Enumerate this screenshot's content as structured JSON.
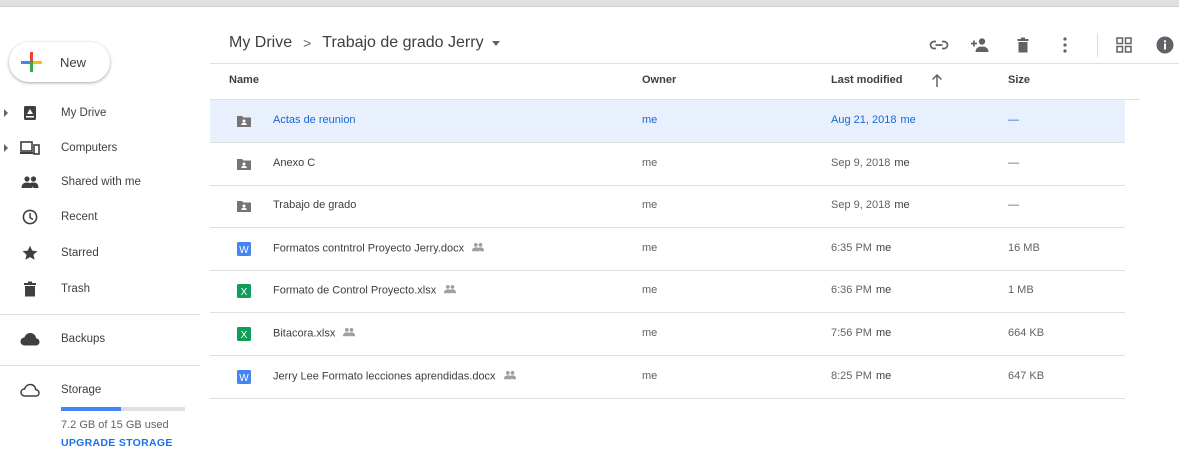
{
  "colors": {
    "accent": "#1a73e8",
    "selected_bg": "#e8f0fe",
    "doc_blue": "#4285f4",
    "sheet_green": "#0f9d58",
    "folder_grey": "#757575"
  },
  "sidebar": {
    "new_label": "New",
    "items": [
      {
        "label": "My Drive",
        "icon": "my-drive-icon"
      },
      {
        "label": "Computers",
        "icon": "computers-icon"
      },
      {
        "label": "Shared with me",
        "icon": "shared-with-me-icon"
      },
      {
        "label": "Recent",
        "icon": "clock-icon"
      },
      {
        "label": "Starred",
        "icon": "star-icon"
      },
      {
        "label": "Trash",
        "icon": "trash-icon"
      },
      {
        "label": "Backups",
        "icon": "cloud-icon"
      },
      {
        "label": "Storage",
        "icon": "cloud-outline-icon"
      }
    ],
    "storage": {
      "used_text": "7.2 GB of 15 GB used",
      "used_fraction": 0.48,
      "upgrade_label": "UPGRADE STORAGE"
    }
  },
  "header": {
    "breadcrumb": [
      "My Drive",
      "Trabajo de grado Jerry"
    ],
    "separator": ">",
    "toolbar_icons": [
      "link-icon",
      "add-person-icon",
      "trash-icon",
      "more-vert-icon",
      "grid-view-icon",
      "info-icon"
    ]
  },
  "table": {
    "columns": {
      "name": "Name",
      "owner": "Owner",
      "modified": "Last modified",
      "size": "Size"
    },
    "rows": [
      {
        "type": "folder",
        "name": "Actas de reunion",
        "shared": false,
        "owner": "me",
        "modified_date": "Aug 21, 2018",
        "modified_by": "me",
        "size": "—",
        "selected": true
      },
      {
        "type": "folder",
        "name": "Anexo C",
        "shared": false,
        "owner": "me",
        "modified_date": "Sep 9, 2018",
        "modified_by": "me",
        "size": "—",
        "selected": false
      },
      {
        "type": "folder",
        "name": "Trabajo de grado",
        "shared": false,
        "owner": "me",
        "modified_date": "Sep 9, 2018",
        "modified_by": "me",
        "size": "—",
        "selected": false
      },
      {
        "type": "doc",
        "name": "Formatos contntrol Proyecto Jerry.docx",
        "shared": true,
        "owner": "me",
        "modified_date": "6:35 PM",
        "modified_by": "me",
        "size": "16 MB",
        "selected": false
      },
      {
        "type": "sheet",
        "name": "Formato de Control Proyecto.xlsx",
        "shared": true,
        "owner": "me",
        "modified_date": "6:36 PM",
        "modified_by": "me",
        "size": "1 MB",
        "selected": false
      },
      {
        "type": "sheet",
        "name": "Bitacora.xlsx",
        "shared": true,
        "owner": "me",
        "modified_date": "7:56 PM",
        "modified_by": "me",
        "size": "664 KB",
        "selected": false
      },
      {
        "type": "doc",
        "name": "Jerry Lee Formato lecciones aprendidas.docx",
        "shared": true,
        "owner": "me",
        "modified_date": "8:25 PM",
        "modified_by": "me",
        "size": "647 KB",
        "selected": false
      }
    ]
  }
}
